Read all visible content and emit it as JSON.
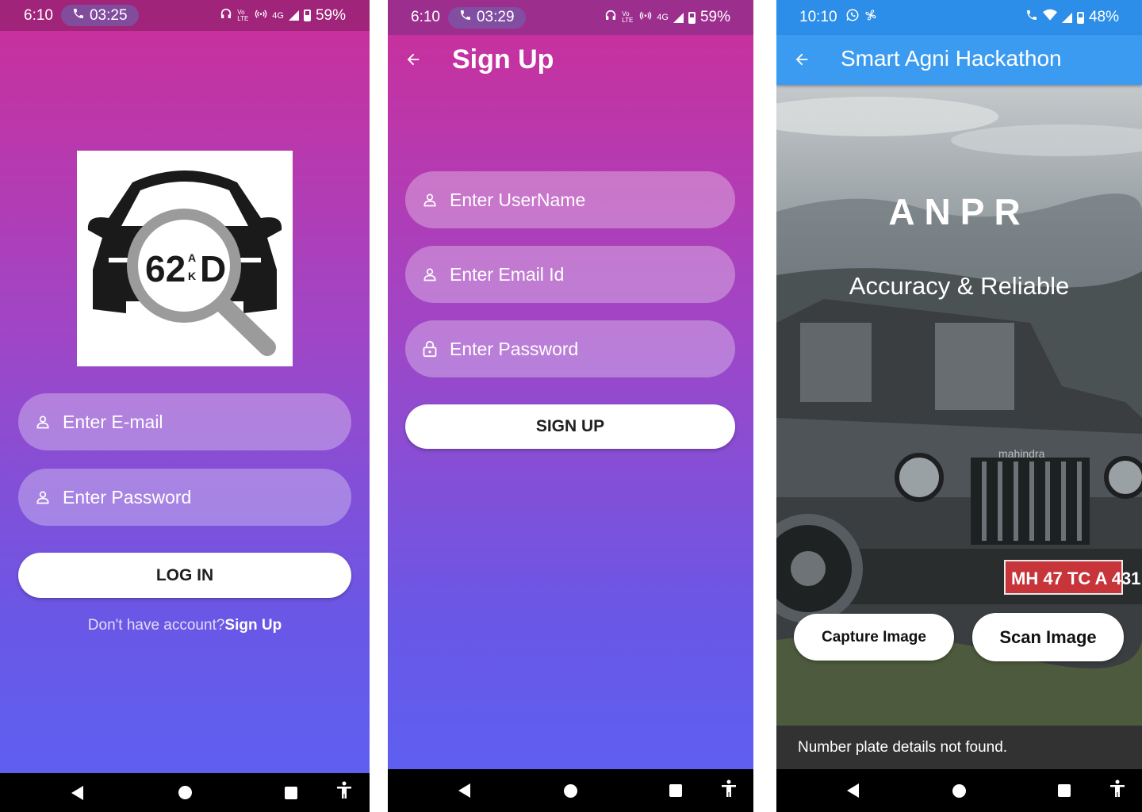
{
  "login": {
    "status": {
      "time": "6:10",
      "call_time": "03:25",
      "battery": "59%",
      "network": "4G",
      "volte": "Vo LTE"
    },
    "logo": {
      "plate_text": "62",
      "plate_small_top": "A",
      "plate_small_bottom": "K",
      "plate_letter": "D"
    },
    "email_placeholder": "Enter E-mail",
    "password_placeholder": "Enter Password",
    "login_button": "LOG IN",
    "no_account_text": "Don't have account?",
    "signup_link": "Sign Up"
  },
  "signup": {
    "status": {
      "time": "6:10",
      "call_time": "03:29",
      "battery": "59%",
      "network": "4G",
      "volte": "Vo LTE"
    },
    "title": "Sign Up",
    "username_placeholder": "Enter UserName",
    "email_placeholder": "Enter Email Id",
    "password_placeholder": "Enter Password",
    "signup_button": "SIGN UP"
  },
  "anpr": {
    "status": {
      "time": "10:10",
      "battery": "48%"
    },
    "title": "Smart Agni Hackathon",
    "heading": "ANPR",
    "subheading": "Accuracy & Reliable",
    "brand_text": "mahindra",
    "plate_text": "MH 47 TC A 431",
    "capture_button": "Capture Image",
    "scan_button": "Scan Image",
    "snackbar_message": "Number plate details not found."
  },
  "colors": {
    "gradient_top": "#cc2e9a",
    "gradient_bottom": "#5e5ff0",
    "appbar_blue": "#3b9bf0",
    "snackbar": "#323232"
  }
}
